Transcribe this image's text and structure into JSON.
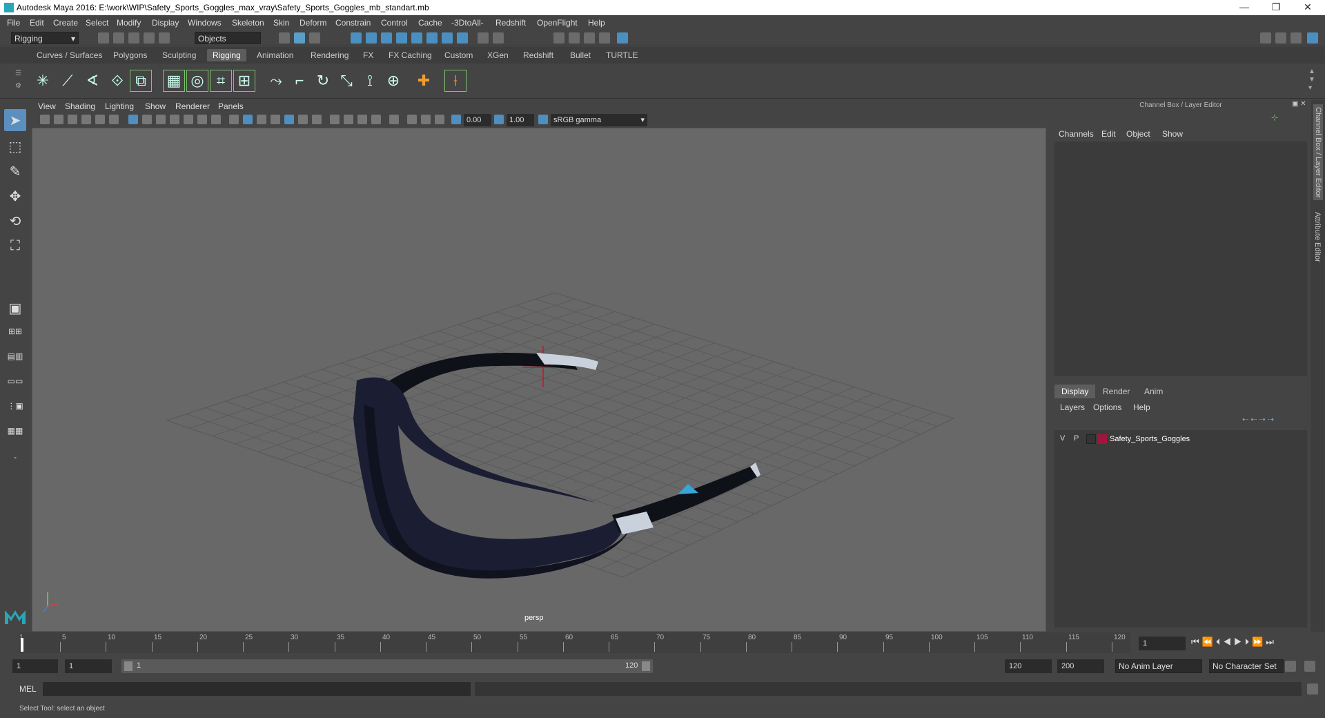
{
  "window": {
    "title": "Autodesk Maya 2016: E:\\work\\WIP\\Safety_Sports_Goggles_max_vray\\Safety_Sports_Goggles_mb_standart.mb",
    "controls": {
      "minimize": "—",
      "restore": "❐",
      "close": "✕"
    }
  },
  "menubar": [
    "File",
    "Edit",
    "Create",
    "Select",
    "Modify",
    "Display",
    "Windows",
    "Skeleton",
    "Skin",
    "Deform",
    "Constrain",
    "Control",
    "Cache",
    "-3DtoAll-",
    "Redshift",
    "OpenFlight",
    "Help"
  ],
  "statusline": {
    "mode": "Rigging",
    "selection_mode": "Objects"
  },
  "shelf": {
    "tabs": [
      "Curves / Surfaces",
      "Polygons",
      "Sculpting",
      "Rigging",
      "Animation",
      "Rendering",
      "FX",
      "FX Caching",
      "Custom",
      "XGen",
      "Redshift",
      "Bullet",
      "TURTLE"
    ],
    "active_tab": "Rigging",
    "icons": [
      "joint-tool-icon",
      "ik-handle-icon",
      "ik-spline-icon",
      "insert-joint-icon",
      "mirror-joint-icon",
      "skin-bind-icon",
      "smooth-bind-icon",
      "lattice-icon",
      "cluster-icon",
      "aim-constraint-icon",
      "parent-constraint-icon",
      "orient-constraint-icon",
      "scale-constraint-icon",
      "pole-vector-icon",
      "point-constraint-icon",
      "locator-icon",
      "ik-fk-icon"
    ]
  },
  "viewport": {
    "menu": [
      "View",
      "Shading",
      "Lighting",
      "Show",
      "Renderer",
      "Panels"
    ],
    "exposure": "0.00",
    "gamma": "1.00",
    "color_space": "sRGB gamma",
    "camera_label": "persp",
    "background": "#686868"
  },
  "channel_box": {
    "title": "Channel Box / Layer Editor",
    "menu": [
      "Channels",
      "Edit",
      "Object",
      "Show"
    ]
  },
  "layer_editor": {
    "tabs": [
      "Display",
      "Render",
      "Anim"
    ],
    "active_tab": "Display",
    "menu": [
      "Layers",
      "Options",
      "Help"
    ],
    "layers": [
      {
        "visible": "V",
        "playback": "P",
        "name": "Safety_Sports_Goggles",
        "color": "#a0153e"
      }
    ]
  },
  "side_tabs": [
    "Channel Box / Layer Editor",
    "Attribute Editor"
  ],
  "timeslider": {
    "ticks": [
      "5",
      "10",
      "15",
      "20",
      "25",
      "30",
      "35",
      "40",
      "45",
      "50",
      "55",
      "60",
      "65",
      "70",
      "75",
      "80",
      "85",
      "90",
      "95",
      "100",
      "105",
      "110",
      "115",
      "120"
    ],
    "start_tick": "1",
    "current_frame": "1"
  },
  "range": {
    "start": "1",
    "playback_start": "1",
    "range_start_label": "1",
    "range_end_label": "120",
    "playback_end": "120",
    "end": "200",
    "anim_layer": "No Anim Layer",
    "character_set": "No Character Set"
  },
  "mel": {
    "label": "MEL"
  },
  "helpline": "Select Tool: select an object"
}
